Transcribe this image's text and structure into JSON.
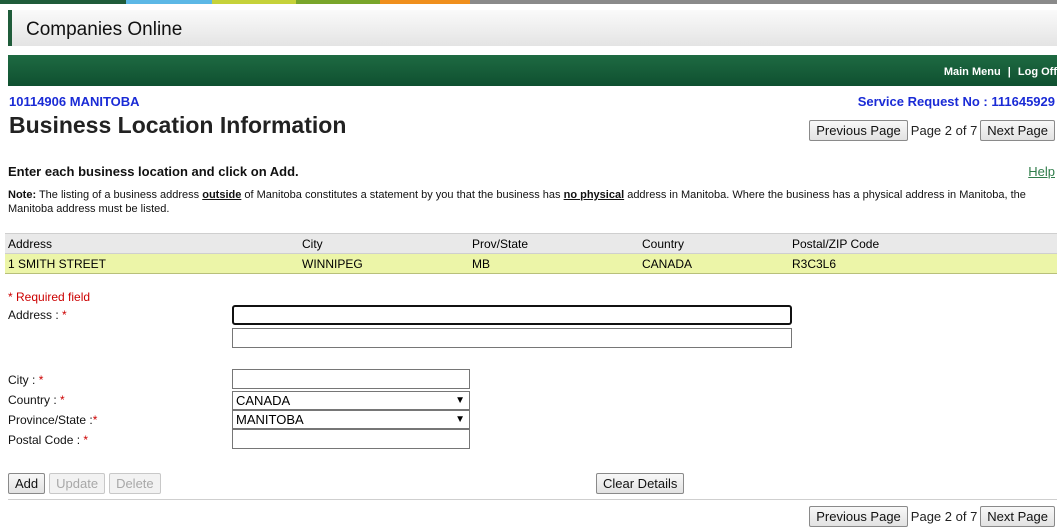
{
  "header": {
    "title": "Companies Online"
  },
  "nav": {
    "main_menu": "Main Menu",
    "separator": "|",
    "log_off": "Log Off"
  },
  "company": {
    "name": "10114906 MANITOBA",
    "service_request": "Service Request No : 111645929"
  },
  "page": {
    "title": "Business Location Information"
  },
  "pager": {
    "previous": "Previous Page",
    "page_info": "Page 2 of 7",
    "next": "Next Page"
  },
  "instructions": {
    "text": "Enter each business location and click on Add.",
    "help": "Help"
  },
  "note": {
    "label": "Note:",
    "part1": " The listing of a business address ",
    "outside": "outside",
    "part2": " of Manitoba constitutes a statement by you that the business has ",
    "no_physical": "no physical",
    "part3": " address in Manitoba. Where the business has a physical address in Manitoba, the Manitoba address must be listed."
  },
  "table": {
    "headers": [
      "Address",
      "City",
      "Prov/State",
      "Country",
      "Postal/ZIP Code"
    ],
    "rows": [
      [
        "1 SMITH STREET",
        "WINNIPEG",
        "MB",
        "CANADA",
        "R3C3L6"
      ]
    ]
  },
  "form": {
    "required_note": "* Required field",
    "address_label": "Address :",
    "city_label": "City :",
    "country_label": "Country :",
    "province_label": "Province/State :",
    "postal_label": "Postal Code :",
    "star": "*",
    "country_value": "CANADA",
    "province_value": "MANITOBA"
  },
  "buttons": {
    "add": "Add",
    "update": "Update",
    "delete": "Delete",
    "clear": "Clear Details"
  },
  "colors": {
    "green": "#1e6a42",
    "link_blue": "#1a2bd6",
    "row_highlight": "#ecf5a8",
    "required_red": "#cc0000"
  },
  "top_stripe": [
    "#1f5c3a",
    "#5cb8e6",
    "#c6d23a",
    "#7aa62b",
    "#f0901e",
    "#8a8a8a"
  ]
}
